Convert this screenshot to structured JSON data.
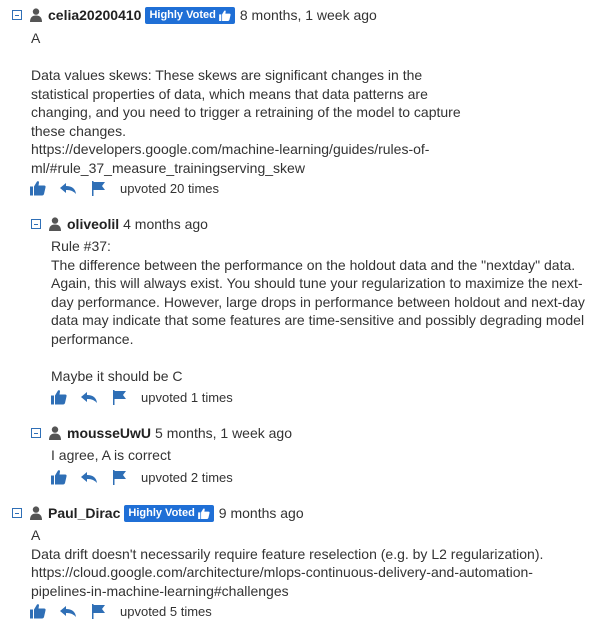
{
  "comments": [
    {
      "username": "celia20200410",
      "badge": "Highly Voted",
      "time": "8 months, 1 week ago",
      "text": "A\n\nData values skews: These skews are significant changes in the\nstatistical properties of data, which means that data patterns are\nchanging, and you need to trigger a retraining of the model to capture\nthese changes.\nhttps://developers.google.com/machine-learning/guides/rules-of-\nml/#rule_37_measure_trainingserving_skew",
      "upvotes": "upvoted 20 times"
    },
    {
      "username": "oliveolil",
      "time": "4 months ago",
      "text": "Rule #37:\nThe difference between the performance on the holdout data and the \"nextday\" data.\nAgain, this will always exist. You should tune your regularization to maximize the next-\nday performance. However, large drops in performance between holdout and next-day\ndata may indicate that some features are time-sensitive and possibly degrading model\nperformance.\n\nMaybe it should be C",
      "upvotes": "upvoted 1 times"
    },
    {
      "username": "mousseUwU",
      "time": "5 months, 1 week ago",
      "text": "I agree, A is correct",
      "upvotes": "upvoted 2 times"
    },
    {
      "username": "Paul_Dirac",
      "badge": "Highly Voted",
      "time": "9 months ago",
      "text": "A\nData drift doesn't necessarily require feature reselection (e.g. by L2 regularization).\nhttps://cloud.google.com/architecture/mlops-continuous-delivery-and-automation-\npipelines-in-machine-learning#challenges",
      "upvotes": "upvoted 5 times"
    }
  ],
  "icons": {
    "toggle": "collapse-toggle-icon",
    "user": "user-icon",
    "upvote": "thumbs-up-icon",
    "reply": "reply-icon",
    "report": "flag-icon"
  },
  "colors": {
    "accent": "#1f6fd6",
    "text": "#333333"
  }
}
